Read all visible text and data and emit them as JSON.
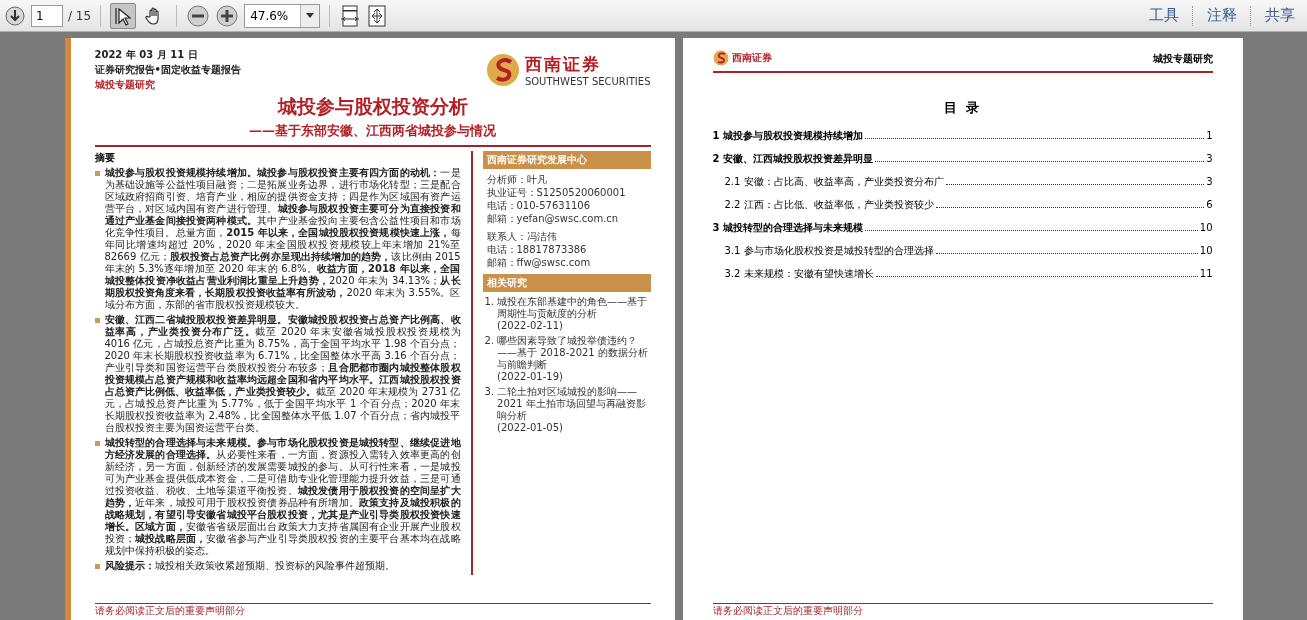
{
  "toolbar": {
    "page_field": {
      "value": "1"
    },
    "page_count": "/ 15",
    "tools": [
      {
        "kind": "select",
        "selected": true
      },
      {
        "kind": "hand",
        "selected": false
      }
    ],
    "zoom_field": {
      "value": "47.6%"
    },
    "right_buttons": [
      "工具",
      "注释",
      "共享"
    ]
  },
  "left_page": {
    "date": "2022 年 03 月 11 日",
    "report_type": "证券研究报告•固定收益专题报告",
    "category": "城投专题研究",
    "logo": {
      "name": "西南证券",
      "english": "SOUTHWEST SECURITIES"
    },
    "title": "城投参与股权投资分析",
    "subtitle": "——基于东部安徽、江西两省城投参与情况",
    "abstract": {
      "heading": "摘要",
      "bullets": [
        "**城投参与股权投资规模持续增加。城投参与股权投资主要有四方面的动机：**一是为基础设施等公益性项目融资；二是拓展业务边界，进行市场化转型；三是配合区域政府招商引资、培育产业，相应的提供资金支持；四是作为区域国有资产运营平台，对区域内国有资产进行管理。**城投参与股权投资主要可分为直接投资和通过产业基金间接投资两种模式。**其中产业基金投向主要包含公益性项目和市场化竞争性项目。总量方面，**2015 年以来，全国城投股权投资规模快速上涨，**每年同比增速均超过 20%，2020 年末全国股权投资规模较上年末增加 21%至 82669 亿元；**股权投资占总资产比例亦呈现出持续增加的趋势，**该比例由 2015 年末的 5.3%逐年增加至 2020 年末的 6.8%。**收益方面，2018 年以来，全国城投整体投资净收益占营业利润比重呈上升趋势，**2020 年末为 34.13%；**从长期股权投资角度来看，长期股权投资收益率有所波动，**2020 年末为 3.55%。区域分布方面，东部的省市股权投资规模较大。",
        "**安徽、江西二省城投股权投资差异明显。安徽城投股权投资占总资产比例高、收益率高，产业类投资分布广泛。**截至 2020 年末安徽省城投股权投资规模为 4016 亿元，占城投总资产比重为 8.75%，高于全国平均水平 1.98 个百分点；2020 年末长期股权投资收益率为 6.71%，比全国整体水平高 3.16 个百分点；产业引导类和国资运营平台类股权投资分布较多；**且合肥都市圈内城投整体股权投资规模占总资产规模和收益率均远超全国和省内平均水平。江西城投股权投资占总资产比例低、收益率低，产业类投资较少。**截至 2020 年末规模为 2731 亿元，占城投总资产比重为 5.77%，低于全国平均水平 1 个百分点；2020 年末长期股权投资收益率为 2.48%，比全国整体水平低 1.07 个百分点；省内城投平台股权投资主要为国资运营平台类。",
        "**城投转型的合理选择与未来规模。参与市场化股权投资是城投转型、继续促进地方经济发展的合理选择。**从必要性来看，一方面，资源投入需转入效率更高的创新经济，另一方面，创新经济的发展需要城投的参与。从可行性来看，一是城投可为产业基金提供低成本资金，二是可借助专业化管理能力提升效益，三是可通过投资收益、税收、土地等渠道平衡投资。**城投发债用于股权投资的空间呈扩大趋势，**近年来，城投可用于股权投资债券品种有所增加。**政策支持及城投积极的战略规划，有望引导安徽省城投平台股权投资，尤其是产业引导类股权投资快速增长。区域方面，**安徽省省级层面出台政策大力支持省属国有企业开展产业股权投资；**城投战略层面，**安徽省参与产业引导类股权投资的主要平台基本均在战略规划中保持积极的姿态。",
        "**风险提示：**城投相关政策收紧超预期、投资标的风险事件超预期。"
      ]
    },
    "sidebar": {
      "center_heading": "西南证券研究发展中心",
      "contact_groups": [
        [
          "分析师：叶凡",
          "执业证号：S1250520060001",
          "电话：010-57631106",
          "邮箱：yefan@swsc.com.cn"
        ],
        [
          "联系人：冯洁伟",
          "电话：18817873386",
          "邮箱：ffw@swsc.com"
        ]
      ],
      "related_heading": "相关研究",
      "related": [
        {
          "number": "1.",
          "text": "城投在东部基建中的角色——基于周期性与贡献度的分析",
          "date": "(2022-02-11)"
        },
        {
          "number": "2.",
          "text": "哪些因素导致了城投举债违约？——基于 2018-2021 的数据分析与前瞻判断",
          "date": "(2022-01-19)"
        },
        {
          "number": "3.",
          "text": "二轮土拍对区域城投的影响——2021 年土拍市场回望与再融资影响分析",
          "date": "(2022-01-05)"
        }
      ]
    },
    "footer": "请务必阅读正文后的重要声明部分"
  },
  "right_page": {
    "logo_name": "西南证券",
    "header": "城投专题研究",
    "toc_title": "目 录",
    "toc": [
      {
        "number": "1",
        "title": "城投参与股权投资规模持续增加",
        "page": "1"
      },
      {
        "number": "2",
        "title": "安徽、江西城投股权投资差异明显",
        "page": "3",
        "children": [
          {
            "number": "2.1",
            "title": "安徽：占比高、收益率高，产业类投资分布广",
            "page": "3"
          },
          {
            "number": "2.2",
            "title": "江西：占比低、收益率低，产业类投资较少",
            "page": "6"
          }
        ]
      },
      {
        "number": "3",
        "title": "城投转型的合理选择与未来规模",
        "page": "10",
        "children": [
          {
            "number": "3.1",
            "title": "参与市场化股权投资是城投转型的合理选择",
            "page": "10"
          },
          {
            "number": "3.2",
            "title": "未来规模：安徽有望快速增长",
            "page": "11"
          }
        ]
      }
    ],
    "footer": "请务必阅读正文后的重要声明部分"
  }
}
